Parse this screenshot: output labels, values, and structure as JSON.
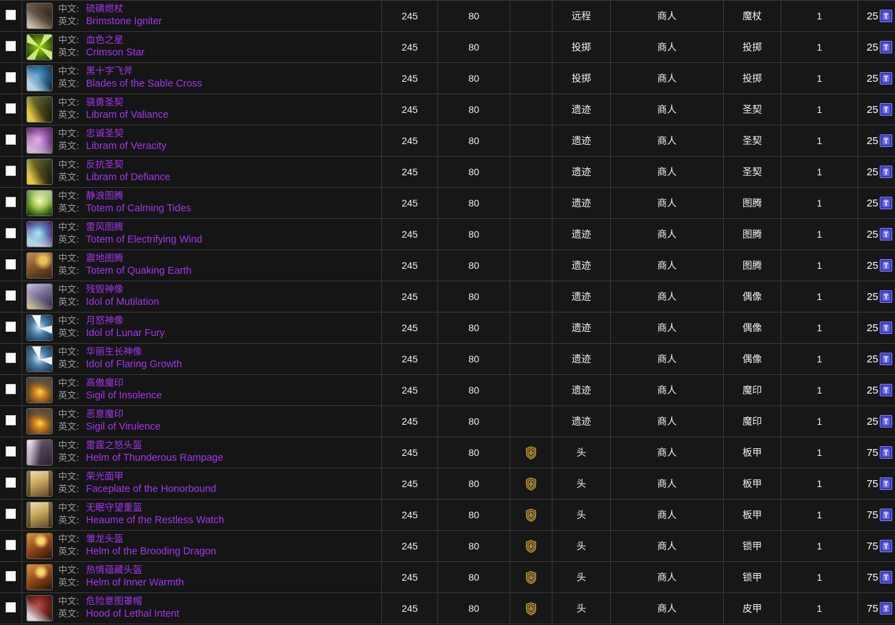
{
  "table": {
    "labels": {
      "cn": "中文:",
      "en": "英文:"
    },
    "colors": {
      "epic": "#a335ee",
      "label_gray": "#9a9a9a",
      "row_bg": "#171717",
      "border": "#3a3a3a",
      "crest_gold": "#c8a13c",
      "token_blue": "#4b4bd8"
    },
    "icons": {
      "checkbox": "checkbox-icon",
      "faction_crest": "alliance-crest-icon",
      "currency_token": "emblem-token-icon"
    },
    "rows": [
      {
        "cn": "硫磺燃杖",
        "en": "Brimstone Igniter",
        "ilvl": "245",
        "level": "80",
        "crest": false,
        "slot": "远程",
        "source": "商人",
        "type": "魔杖",
        "qty": "1",
        "cost": "25",
        "icon": {
          "bg": "linear-gradient(150deg,#6b5a4a 0%,#3a2f26 55%,#201914 100%)",
          "fg": "linear-gradient(35deg,rgba(220,205,185,0.9) 12%,rgba(120,100,80,0.6) 48%,rgba(30,24,18,0) 70%)"
        }
      },
      {
        "cn": "血色之星",
        "en": "Crimson Star",
        "ilvl": "245",
        "level": "80",
        "crest": false,
        "slot": "投掷",
        "source": "商人",
        "type": "投掷",
        "qty": "1",
        "cost": "25",
        "icon": {
          "bg": "radial-gradient(circle at 50% 50%,#9fd11a 0%,#5d8a10 45%,#1c2a06 100%)",
          "fg": "conic-gradient(from 20deg,rgba(230,255,140,0.85) 0 8%,rgba(0,0,0,0) 8% 25%,rgba(230,255,140,0.85) 25% 33%,rgba(0,0,0,0) 33% 50%,rgba(230,255,140,0.85) 50% 58%,rgba(0,0,0,0) 58% 75%,rgba(230,255,140,0.85) 75% 83%,rgba(0,0,0,0) 83% 100%)"
        }
      },
      {
        "cn": "黑十字飞斧",
        "en": "Blades of the Sable Cross",
        "ilvl": "245",
        "level": "80",
        "crest": false,
        "slot": "投掷",
        "source": "商人",
        "type": "投掷",
        "qty": "1",
        "cost": "25",
        "icon": {
          "bg": "radial-gradient(circle at 40% 40%,#5aa8d8 0%,#24557e 55%,#0c1d2e 100%)",
          "fg": "linear-gradient(45deg,rgba(210,235,250,0.85) 20%,rgba(20,40,60,0) 55%)"
        }
      },
      {
        "cn": "骁勇圣契",
        "en": "Libram of Valiance",
        "ilvl": "245",
        "level": "80",
        "crest": false,
        "slot": "遗迹",
        "source": "商人",
        "type": "圣契",
        "qty": "1",
        "cost": "25",
        "icon": {
          "bg": "linear-gradient(135deg,#6f7a3a 0%,#2f3418 60%,#13150a 100%)",
          "fg": "linear-gradient(60deg,rgba(245,215,70,0.9) 18%,rgba(120,100,20,0.35) 50%,rgba(0,0,0,0) 72%)"
        }
      },
      {
        "cn": "忠诚圣契",
        "en": "Libram of Veracity",
        "ilvl": "245",
        "level": "80",
        "crest": false,
        "slot": "遗迹",
        "source": "商人",
        "type": "圣契",
        "qty": "1",
        "cost": "25",
        "icon": {
          "bg": "radial-gradient(circle at 45% 45%,#e2a5e8 0%,#8e4fa0 50%,#32143c 100%)",
          "fg": "linear-gradient(30deg,rgba(255,235,255,0.7) 15%,rgba(60,20,70,0) 60%)"
        }
      },
      {
        "cn": "反抗圣契",
        "en": "Libram of Defiance",
        "ilvl": "245",
        "level": "80",
        "crest": false,
        "slot": "遗迹",
        "source": "商人",
        "type": "圣契",
        "qty": "1",
        "cost": "25",
        "icon": {
          "bg": "linear-gradient(135deg,#6f7a3a 0%,#2f3418 60%,#13150a 100%)",
          "fg": "linear-gradient(60deg,rgba(245,215,70,0.9) 18%,rgba(120,100,20,0.35) 50%,rgba(0,0,0,0) 72%)"
        }
      },
      {
        "cn": "静浪图腾",
        "en": "Totem of Calming Tides",
        "ilvl": "245",
        "level": "80",
        "crest": false,
        "slot": "遗迹",
        "source": "商人",
        "type": "图腾",
        "qty": "1",
        "cost": "25",
        "icon": {
          "bg": "radial-gradient(circle at 50% 42%,#f2f7c8 0%,#9ec44a 38%,#3e6a18 72%,#16250a 100%)",
          "fg": "linear-gradient(200deg,rgba(255,255,220,0.55) 10%,rgba(0,0,0,0) 55%)"
        }
      },
      {
        "cn": "雷风图腾",
        "en": "Totem of Electrifying Wind",
        "ilvl": "245",
        "level": "80",
        "crest": false,
        "slot": "遗迹",
        "source": "商人",
        "type": "图腾",
        "qty": "1",
        "cost": "25",
        "icon": {
          "bg": "radial-gradient(circle at 45% 45%,#a8e8f2 0%,#5a7fb8 40%,#5a2a7a 75%,#1c0c2a 100%)",
          "fg": "linear-gradient(25deg,rgba(200,245,255,0.8) 20%,rgba(40,20,70,0) 62%)"
        }
      },
      {
        "cn": "震地图腾",
        "en": "Totem of Quaking Earth",
        "ilvl": "245",
        "level": "80",
        "crest": false,
        "slot": "遗迹",
        "source": "商人",
        "type": "图腾",
        "qty": "1",
        "cost": "25",
        "icon": {
          "bg": "linear-gradient(160deg,#c08a52 0%,#8a5a2e 45%,#3b2212 100%)",
          "fg": "radial-gradient(circle at 65% 30%,rgba(250,210,90,0.85) 0 14%,rgba(0,0,0,0) 40%)"
        }
      },
      {
        "cn": "残毁神像",
        "en": "Idol of Mutilation",
        "ilvl": "245",
        "level": "80",
        "crest": false,
        "slot": "遗迹",
        "source": "商人",
        "type": "偶像",
        "qty": "1",
        "cost": "25",
        "icon": {
          "bg": "linear-gradient(150deg,#c9c2e0 0%,#7a6f9a 45%,#2a2440 100%)",
          "fg": "linear-gradient(30deg,rgba(240,225,150,0.75) 10%,rgba(40,35,60,0) 48%)"
        }
      },
      {
        "cn": "月怒神像",
        "en": "Idol of Lunar Fury",
        "ilvl": "245",
        "level": "80",
        "crest": false,
        "slot": "遗迹",
        "source": "商人",
        "type": "偶像",
        "qty": "1",
        "cost": "25",
        "icon": {
          "bg": "radial-gradient(circle at 48% 48%,#cfe8f5 0%,#4a7fa8 42%,#16293c 100%)",
          "fg": "conic-gradient(from 330deg at 50% 52%,rgba(250,252,255,0.95) 0 10%,rgba(0,0,0,0) 10% 30%,rgba(250,252,255,0.9) 30% 40%,rgba(0,0,0,0) 40% 100%)"
        }
      },
      {
        "cn": "华丽生长神像",
        "en": "Idol of Flaring Growth",
        "ilvl": "245",
        "level": "80",
        "crest": false,
        "slot": "遗迹",
        "source": "商人",
        "type": "偶像",
        "qty": "1",
        "cost": "25",
        "icon": {
          "bg": "radial-gradient(circle at 48% 48%,#cfe8f5 0%,#4a7fa8 42%,#16293c 100%)",
          "fg": "conic-gradient(from 330deg at 50% 52%,rgba(250,252,255,0.95) 0 10%,rgba(0,0,0,0) 10% 30%,rgba(250,252,255,0.9) 30% 40%,rgba(0,0,0,0) 40% 100%)"
        }
      },
      {
        "cn": "高傲魔印",
        "en": "Sigil of Insolence",
        "ilvl": "245",
        "level": "80",
        "crest": false,
        "slot": "遗迹",
        "source": "商人",
        "type": "魔印",
        "qty": "1",
        "cost": "25",
        "icon": {
          "bg": "radial-gradient(circle at 52% 58%,#ffd24a 0%,#c97a18 32%,#6a4a22 62%,#241a10 100%)",
          "fg": "linear-gradient(200deg,rgba(90,80,70,0.8) 0 22%,rgba(0,0,0,0) 50%)"
        }
      },
      {
        "cn": "恶意魔印",
        "en": "Sigil of Virulence",
        "ilvl": "245",
        "level": "80",
        "crest": false,
        "slot": "遗迹",
        "source": "商人",
        "type": "魔印",
        "qty": "1",
        "cost": "25",
        "icon": {
          "bg": "radial-gradient(circle at 52% 58%,#ffd24a 0%,#c97a18 32%,#6a4a22 62%,#241a10 100%)",
          "fg": "linear-gradient(200deg,rgba(90,80,70,0.8) 0 22%,rgba(0,0,0,0) 50%)"
        }
      },
      {
        "cn": "雷霆之怒头盔",
        "en": "Helm of Thunderous Rampage",
        "ilvl": "245",
        "level": "80",
        "crest": true,
        "slot": "头",
        "source": "商人",
        "type": "板甲",
        "qty": "1",
        "cost": "75",
        "icon": {
          "bg": "linear-gradient(150deg,#d8c8d8 0%,#8a7a90 40%,#3a2c3e 100%)",
          "fg": "linear-gradient(95deg,rgba(255,250,255,0.45) 18%,rgba(30,20,35,0.5) 55%)"
        }
      },
      {
        "cn": "荣光面甲",
        "en": "Faceplate of the Honorbound",
        "ilvl": "245",
        "level": "80",
        "crest": true,
        "slot": "头",
        "source": "商人",
        "type": "板甲",
        "qty": "1",
        "cost": "75",
        "icon": {
          "bg": "linear-gradient(160deg,#f0e0b4 0%,#c8a85e 45%,#5a4420 100%)",
          "fg": "linear-gradient(90deg,rgba(40,30,12,0.55) 0 14%,rgba(0,0,0,0) 14% 86%,rgba(40,30,12,0.55) 86% 100%)"
        }
      },
      {
        "cn": "无眠守望重盔",
        "en": "Heaume of the Restless Watch",
        "ilvl": "245",
        "level": "80",
        "crest": true,
        "slot": "头",
        "source": "商人",
        "type": "板甲",
        "qty": "1",
        "cost": "75",
        "icon": {
          "bg": "linear-gradient(160deg,#f0e0b4 0%,#c8a85e 45%,#5a4420 100%)",
          "fg": "linear-gradient(90deg,rgba(40,30,12,0.55) 0 14%,rgba(0,0,0,0) 14% 86%,rgba(40,30,12,0.55) 86% 100%)"
        }
      },
      {
        "cn": "雏龙头盔",
        "en": "Helm of the Brooding Dragon",
        "ilvl": "245",
        "level": "80",
        "crest": true,
        "slot": "头",
        "source": "商人",
        "type": "锁甲",
        "qty": "1",
        "cost": "75",
        "icon": {
          "bg": "linear-gradient(150deg,#d89a3a 0%,#9a4a18 45%,#2e1208 100%)",
          "fg": "radial-gradient(circle at 56% 30%,rgba(255,230,120,0.9) 0 12%,rgba(0,0,0,0) 34%)"
        }
      },
      {
        "cn": "热情蕴藏头盔",
        "en": "Helm of Inner Warmth",
        "ilvl": "245",
        "level": "80",
        "crest": true,
        "slot": "头",
        "source": "商人",
        "type": "锁甲",
        "qty": "1",
        "cost": "75",
        "icon": {
          "bg": "linear-gradient(150deg,#d89a3a 0%,#9a4a18 45%,#2e1208 100%)",
          "fg": "radial-gradient(circle at 56% 30%,rgba(255,230,120,0.9) 0 12%,rgba(0,0,0,0) 34%)"
        }
      },
      {
        "cn": "危险意图罩帽",
        "en": "Hood of Lethal Intent",
        "ilvl": "245",
        "level": "80",
        "crest": true,
        "slot": "头",
        "source": "商人",
        "type": "皮甲",
        "qty": "1",
        "cost": "75",
        "icon": {
          "bg": "radial-gradient(circle at 45% 40%,#b8504a 0%,#7a2420 45%,#2a0c0a 100%)",
          "fg": "linear-gradient(40deg,rgba(235,235,240,0.9) 16%,rgba(60,20,20,0) 52%)"
        }
      }
    ]
  }
}
